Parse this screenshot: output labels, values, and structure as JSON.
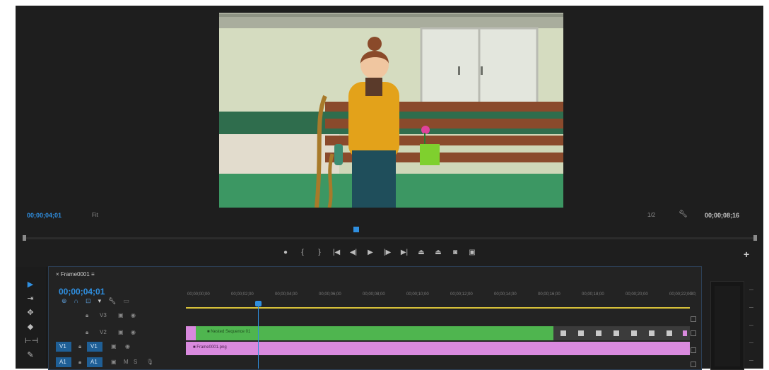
{
  "monitor": {
    "playhead_timecode": "00;00;04;01",
    "fit_label": "Fit",
    "scale_label": "1/2",
    "duration_timecode": "00;00;08;16"
  },
  "transport": {
    "buttons": [
      "add-marker",
      "mark-in",
      "mark-out",
      "go-to-in",
      "step-back",
      "play",
      "step-forward",
      "go-to-out",
      "lift",
      "extract",
      "export-frame",
      "comparison-view"
    ]
  },
  "timeline": {
    "sequence_name": "Frame0001",
    "timecode": "00;00;04;01",
    "ruler_labels": [
      "00;00;00;00",
      "00;00;02;00",
      "00;00;04;00",
      "00;00;06;00",
      "00;00;08;00",
      "00;00;10;00",
      "00;00;12;00",
      "00;00;14;00",
      "00;00;16;00",
      "00;00;18;00",
      "00;00;20;00",
      "00;00;22;00",
      "00;"
    ],
    "tracks": {
      "v3": "V3",
      "v2": "V2",
      "v1": "V1",
      "a1": "A1",
      "source_v1": "V1",
      "source_a1": "A1"
    },
    "clips": {
      "green_label": "Nested Sequence 01",
      "pink_label": "Frame0001.png"
    }
  },
  "colors": {
    "accent": "#2f8fe0",
    "clip_green": "#4fb54f",
    "clip_pink": "#d98ade",
    "work_area": "#d8c23a"
  }
}
